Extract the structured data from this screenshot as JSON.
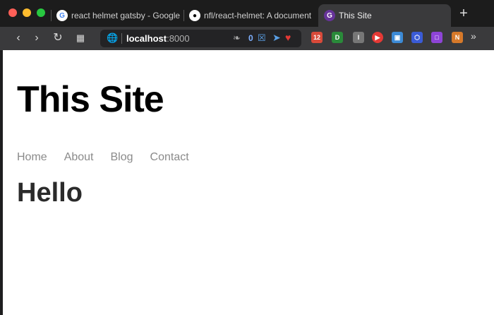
{
  "tabs": [
    {
      "label": "react helmet gatsby - Google",
      "icon": "google-icon",
      "active": false
    },
    {
      "label": "nfl/react-helmet: A document",
      "icon": "github-icon",
      "active": false
    },
    {
      "label": "This Site",
      "icon": "gatsby-icon",
      "active": true
    }
  ],
  "toolbar": {
    "address_host": "localhost",
    "address_port": ":8000",
    "ext_counter": "0"
  },
  "extensions": [
    {
      "name": "ext-12",
      "label": "12",
      "color": "#d84a3a"
    },
    {
      "name": "ext-d",
      "label": "D",
      "color": "#2a8a3a"
    },
    {
      "name": "ext-i",
      "label": "I",
      "color": "#777777"
    },
    {
      "name": "ext-play",
      "label": "▶",
      "color": "#e53935"
    },
    {
      "name": "ext-save",
      "label": "▣",
      "color": "#3c8ad6"
    },
    {
      "name": "ext-hex",
      "label": "⬡",
      "color": "#3a5bd6"
    },
    {
      "name": "ext-square",
      "label": "□",
      "color": "#8e44d6"
    },
    {
      "name": "ext-n",
      "label": "N",
      "color": "#d6792a"
    }
  ],
  "page": {
    "site_title": "This Site",
    "nav": [
      "Home",
      "About",
      "Blog",
      "Contact"
    ],
    "heading": "Hello"
  }
}
